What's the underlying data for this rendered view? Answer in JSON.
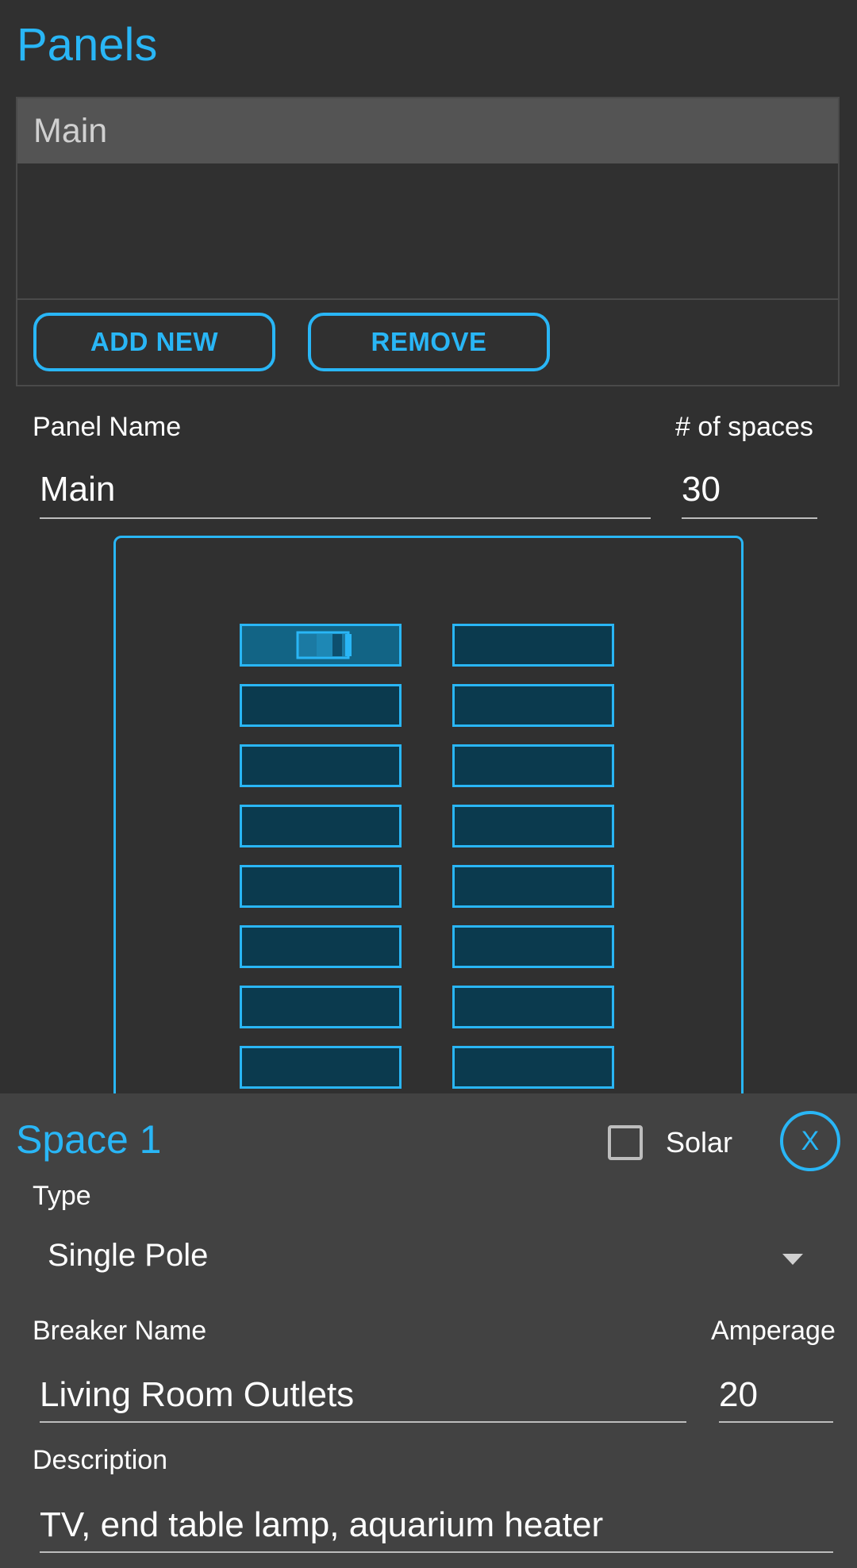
{
  "header": {
    "title": "Panels"
  },
  "panels_list": {
    "items": [
      {
        "label": "Main",
        "selected": true
      }
    ],
    "add_label": "ADD NEW",
    "remove_label": "REMOVE"
  },
  "panel_form": {
    "name_label": "Panel Name",
    "name_value": "Main",
    "spaces_label": "# of spaces",
    "spaces_value": "30"
  },
  "breaker_diagram": {
    "visible_rows": 8,
    "columns": 2,
    "selected_space": 1
  },
  "space_editor": {
    "title": "Space 1",
    "solar_label": "Solar",
    "solar_checked": false,
    "close_label": "X",
    "type_label": "Type",
    "type_value": "Single Pole",
    "breaker_name_label": "Breaker Name",
    "breaker_name_value": "Living Room Outlets",
    "amperage_label": "Amperage",
    "amperage_value": "20",
    "description_label": "Description",
    "description_value": "TV, end table lamp, aquarium heater"
  },
  "colors": {
    "accent": "#29b6f6",
    "background": "#303030",
    "sheet": "#424242",
    "slot_fill": "#0b3a4e",
    "slot_selected": "#126485"
  }
}
